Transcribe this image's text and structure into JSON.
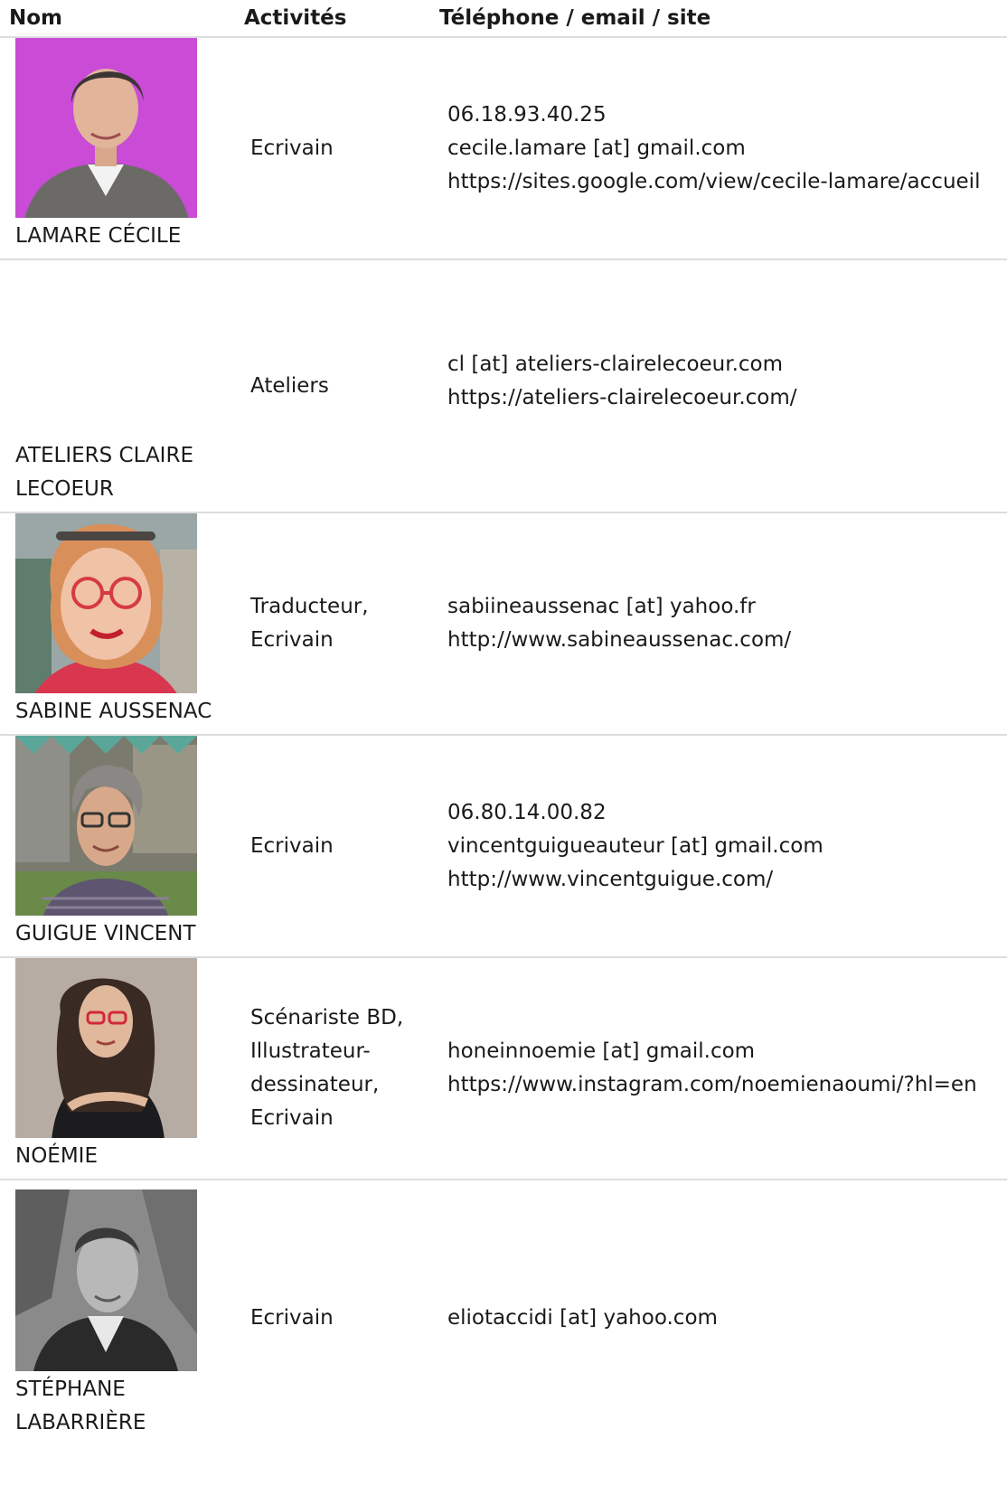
{
  "header": {
    "nom": "Nom",
    "activites": "Activités",
    "contact": "Téléphone / email / site"
  },
  "rows": [
    {
      "name": "LAMARE CÉCILE",
      "activity_lines": [
        "Ecrivain"
      ],
      "contact_lines": [
        "06.18.93.40.25",
        "cecile.lamare [at] gmail.com",
        "https://sites.google.com/view/cecile-lamare/accueil"
      ],
      "photo": "portrait-woman-magenta-background"
    },
    {
      "name_lines": [
        "ATELIERS CLAIRE",
        "LECOEUR"
      ],
      "activity_lines": [
        "Ateliers"
      ],
      "contact_lines": [
        "cl [at] ateliers-clairelecoeur.com",
        "https://ateliers-clairelecoeur.com/"
      ]
    },
    {
      "name": "SABINE AUSSENAC",
      "activity_lines": [
        "Traducteur,",
        "Ecrivain"
      ],
      "contact_lines": [
        "sabiineaussenac [at] yahoo.fr",
        "http://www.sabineaussenac.com/"
      ],
      "photo": "portrait-woman-red-glasses"
    },
    {
      "name": "GUIGUE VINCENT",
      "activity_lines": [
        "Ecrivain"
      ],
      "contact_lines": [
        "06.80.14.00.82",
        "vincentguigueauteur [at] gmail.com",
        "http://www.vincentguigue.com/"
      ],
      "photo": "portrait-man-glasses-striped-shirt"
    },
    {
      "name": "NOÉMIE",
      "activity_lines": [
        "Scénariste BD,",
        "Illustrateur-",
        "dessinateur,",
        "Ecrivain"
      ],
      "contact_lines": [
        "honeinnoemie [at] gmail.com",
        "https://www.instagram.com/noemienaoumi/?hl=en"
      ],
      "photo": "portrait-woman-dark-hair-red-glasses"
    },
    {
      "name_lines": [
        "STÉPHANE",
        "LABARRIÈRE"
      ],
      "activity_lines": [
        "Ecrivain"
      ],
      "contact_lines": [
        "eliotaccidi [at] yahoo.com"
      ],
      "photo": "portrait-man-black-white"
    }
  ]
}
